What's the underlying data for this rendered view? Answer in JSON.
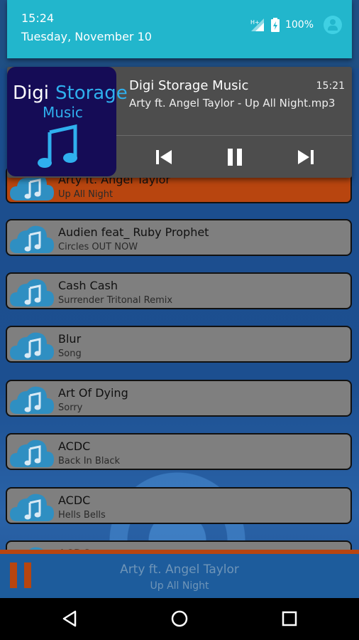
{
  "status": {
    "time": "15:24",
    "date": "Tuesday, November 10",
    "battery": "100%"
  },
  "notification": {
    "app_name": "Digi Storage Music",
    "time": "15:21",
    "track": "Arty ft. Angel Taylor - Up All Night.mp3",
    "art": {
      "line1a": "Digi",
      "line1b": "Storage",
      "line2": "Music"
    }
  },
  "songs": [
    {
      "artist": "Arty ft. Angel Taylor",
      "title": "Up All Night"
    },
    {
      "artist": "Audien feat_ Ruby Prophet",
      "title": "Circles OUT NOW"
    },
    {
      "artist": "Cash Cash",
      "title": "Surrender Tritonal Remix"
    },
    {
      "artist": "Blur",
      "title": "Song"
    },
    {
      "artist": "Art Of Dying",
      "title": "Sorry"
    },
    {
      "artist": "ACDC",
      "title": "Back In Black"
    },
    {
      "artist": "ACDC",
      "title": "Hells Bells"
    },
    {
      "artist": "ACDC",
      "title": ""
    }
  ],
  "now_playing": {
    "artist": "Arty ft. Angel Taylor",
    "title": "Up All Night"
  },
  "colors": {
    "accent": "#b8450f",
    "cloud": "#2f8fc2",
    "status_panel": "#22b6cc"
  }
}
